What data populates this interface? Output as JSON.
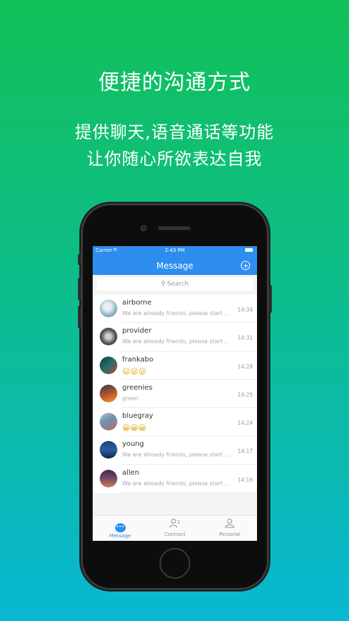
{
  "promo": {
    "headline": "便捷的沟通方式",
    "line1": "提供聊天,语音通话等功能",
    "line2": "让你随心所欲表达自我"
  },
  "status_bar": {
    "carrier": "Carrier",
    "time": "2:43 PM"
  },
  "nav": {
    "title": "Message",
    "accent": "#2d8eef"
  },
  "search": {
    "placeholder": "Search"
  },
  "conversations": [
    {
      "name": "airborne",
      "preview": "We are already friends, please start ...",
      "time": "14:34",
      "avatar_color": "#8fb7c9"
    },
    {
      "name": "provider",
      "preview": "We are already friends, please start ...",
      "time": "14:31",
      "avatar_color": "#5a5a5a"
    },
    {
      "name": "frankabo",
      "preview": "😛😛😛",
      "time": "14:28",
      "avatar_color": "#2a6f6a"
    },
    {
      "name": "greenies",
      "preview": "green",
      "time": "14:25",
      "avatar_color": "#c0562a"
    },
    {
      "name": "bluegray",
      "preview": "😀😀😀",
      "time": "14:24",
      "avatar_color": "#6f8fb0"
    },
    {
      "name": "young",
      "preview": "We are already friends, please start ...",
      "time": "14:17",
      "avatar_color": "#2a5f9e"
    },
    {
      "name": "allen",
      "preview": "We are already friends, please start ...",
      "time": "14:16",
      "avatar_color": "#7a4a6a"
    }
  ],
  "tabs": [
    {
      "label": "Message",
      "icon": "chat-bubble-icon",
      "active": true
    },
    {
      "label": "Contract",
      "icon": "contacts-icon",
      "active": false
    },
    {
      "label": "Personal",
      "icon": "person-icon",
      "active": false
    }
  ]
}
